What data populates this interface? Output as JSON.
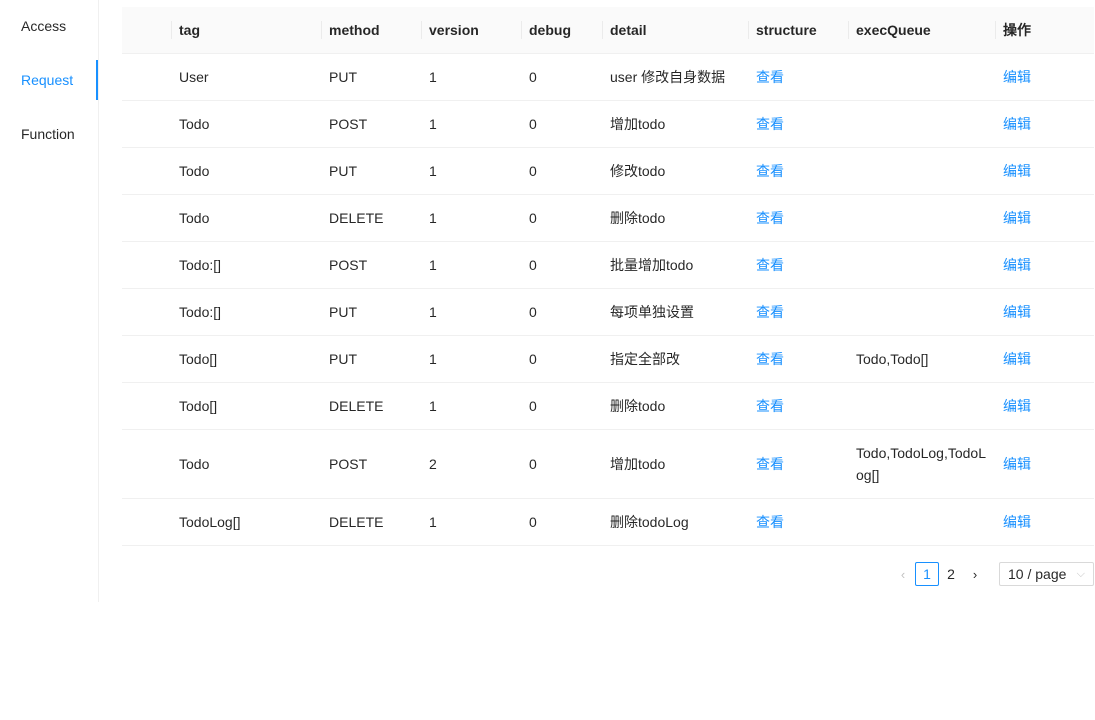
{
  "sidebar": {
    "items": [
      {
        "label": "Access"
      },
      {
        "label": "Request"
      },
      {
        "label": "Function"
      }
    ],
    "active_index": 1
  },
  "table": {
    "columns": [
      "tag",
      "method",
      "version",
      "debug",
      "detail",
      "structure",
      "execQueue",
      "操作"
    ],
    "rows": [
      {
        "tag": "User",
        "method": "PUT",
        "version": "1",
        "debug": "0",
        "detail": "user 修改自身数据",
        "structure": "查看",
        "execQueue": "",
        "action": "编辑"
      },
      {
        "tag": "Todo",
        "method": "POST",
        "version": "1",
        "debug": "0",
        "detail": "增加todo",
        "structure": "查看",
        "execQueue": "",
        "action": "编辑"
      },
      {
        "tag": "Todo",
        "method": "PUT",
        "version": "1",
        "debug": "0",
        "detail": "修改todo",
        "structure": "查看",
        "execQueue": "",
        "action": "编辑"
      },
      {
        "tag": "Todo",
        "method": "DELETE",
        "version": "1",
        "debug": "0",
        "detail": "删除todo",
        "structure": "查看",
        "execQueue": "",
        "action": "编辑"
      },
      {
        "tag": "Todo:[]",
        "method": "POST",
        "version": "1",
        "debug": "0",
        "detail": "批量增加todo",
        "structure": "查看",
        "execQueue": "",
        "action": "编辑"
      },
      {
        "tag": "Todo:[]",
        "method": "PUT",
        "version": "1",
        "debug": "0",
        "detail": "每项单独设置",
        "structure": "查看",
        "execQueue": "",
        "action": "编辑"
      },
      {
        "tag": "Todo[]",
        "method": "PUT",
        "version": "1",
        "debug": "0",
        "detail": "指定全部改",
        "structure": "查看",
        "execQueue": "Todo,Todo[]",
        "action": "编辑"
      },
      {
        "tag": "Todo[]",
        "method": "DELETE",
        "version": "1",
        "debug": "0",
        "detail": "删除todo",
        "structure": "查看",
        "execQueue": "",
        "action": "编辑"
      },
      {
        "tag": "Todo",
        "method": "POST",
        "version": "2",
        "debug": "0",
        "detail": "增加todo",
        "structure": "查看",
        "execQueue": "Todo,TodoLog,TodoLog[]",
        "action": "编辑"
      },
      {
        "tag": "TodoLog[]",
        "method": "DELETE",
        "version": "1",
        "debug": "0",
        "detail": "删除todoLog",
        "structure": "查看",
        "execQueue": "",
        "action": "编辑"
      }
    ]
  },
  "pagination": {
    "prev_icon": "chevron-left-icon",
    "next_icon": "chevron-right-icon",
    "pages": [
      "1",
      "2"
    ],
    "current_page": "1",
    "page_size": "10 / page",
    "prev_glyph": "‹",
    "next_glyph": "›",
    "size_glyph": "⌵"
  },
  "colors": {
    "accent": "#1890ff",
    "header_bg": "#fafafa",
    "border": "#f0f0f0"
  }
}
